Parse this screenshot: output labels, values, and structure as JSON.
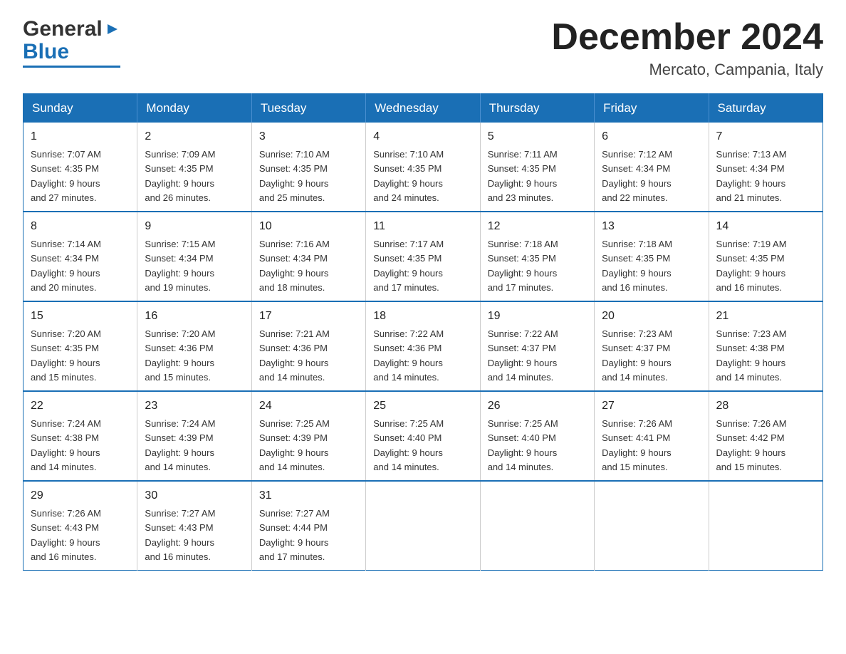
{
  "logo": {
    "general": "General",
    "blue": "Blue"
  },
  "header": {
    "month_year": "December 2024",
    "location": "Mercato, Campania, Italy"
  },
  "days_of_week": [
    "Sunday",
    "Monday",
    "Tuesday",
    "Wednesday",
    "Thursday",
    "Friday",
    "Saturday"
  ],
  "weeks": [
    [
      {
        "day": "1",
        "sunrise": "7:07 AM",
        "sunset": "4:35 PM",
        "daylight": "9 hours and 27 minutes."
      },
      {
        "day": "2",
        "sunrise": "7:09 AM",
        "sunset": "4:35 PM",
        "daylight": "9 hours and 26 minutes."
      },
      {
        "day": "3",
        "sunrise": "7:10 AM",
        "sunset": "4:35 PM",
        "daylight": "9 hours and 25 minutes."
      },
      {
        "day": "4",
        "sunrise": "7:10 AM",
        "sunset": "4:35 PM",
        "daylight": "9 hours and 24 minutes."
      },
      {
        "day": "5",
        "sunrise": "7:11 AM",
        "sunset": "4:35 PM",
        "daylight": "9 hours and 23 minutes."
      },
      {
        "day": "6",
        "sunrise": "7:12 AM",
        "sunset": "4:34 PM",
        "daylight": "9 hours and 22 minutes."
      },
      {
        "day": "7",
        "sunrise": "7:13 AM",
        "sunset": "4:34 PM",
        "daylight": "9 hours and 21 minutes."
      }
    ],
    [
      {
        "day": "8",
        "sunrise": "7:14 AM",
        "sunset": "4:34 PM",
        "daylight": "9 hours and 20 minutes."
      },
      {
        "day": "9",
        "sunrise": "7:15 AM",
        "sunset": "4:34 PM",
        "daylight": "9 hours and 19 minutes."
      },
      {
        "day": "10",
        "sunrise": "7:16 AM",
        "sunset": "4:34 PM",
        "daylight": "9 hours and 18 minutes."
      },
      {
        "day": "11",
        "sunrise": "7:17 AM",
        "sunset": "4:35 PM",
        "daylight": "9 hours and 17 minutes."
      },
      {
        "day": "12",
        "sunrise": "7:18 AM",
        "sunset": "4:35 PM",
        "daylight": "9 hours and 17 minutes."
      },
      {
        "day": "13",
        "sunrise": "7:18 AM",
        "sunset": "4:35 PM",
        "daylight": "9 hours and 16 minutes."
      },
      {
        "day": "14",
        "sunrise": "7:19 AM",
        "sunset": "4:35 PM",
        "daylight": "9 hours and 16 minutes."
      }
    ],
    [
      {
        "day": "15",
        "sunrise": "7:20 AM",
        "sunset": "4:35 PM",
        "daylight": "9 hours and 15 minutes."
      },
      {
        "day": "16",
        "sunrise": "7:20 AM",
        "sunset": "4:36 PM",
        "daylight": "9 hours and 15 minutes."
      },
      {
        "day": "17",
        "sunrise": "7:21 AM",
        "sunset": "4:36 PM",
        "daylight": "9 hours and 14 minutes."
      },
      {
        "day": "18",
        "sunrise": "7:22 AM",
        "sunset": "4:36 PM",
        "daylight": "9 hours and 14 minutes."
      },
      {
        "day": "19",
        "sunrise": "7:22 AM",
        "sunset": "4:37 PM",
        "daylight": "9 hours and 14 minutes."
      },
      {
        "day": "20",
        "sunrise": "7:23 AM",
        "sunset": "4:37 PM",
        "daylight": "9 hours and 14 minutes."
      },
      {
        "day": "21",
        "sunrise": "7:23 AM",
        "sunset": "4:38 PM",
        "daylight": "9 hours and 14 minutes."
      }
    ],
    [
      {
        "day": "22",
        "sunrise": "7:24 AM",
        "sunset": "4:38 PM",
        "daylight": "9 hours and 14 minutes."
      },
      {
        "day": "23",
        "sunrise": "7:24 AM",
        "sunset": "4:39 PM",
        "daylight": "9 hours and 14 minutes."
      },
      {
        "day": "24",
        "sunrise": "7:25 AM",
        "sunset": "4:39 PM",
        "daylight": "9 hours and 14 minutes."
      },
      {
        "day": "25",
        "sunrise": "7:25 AM",
        "sunset": "4:40 PM",
        "daylight": "9 hours and 14 minutes."
      },
      {
        "day": "26",
        "sunrise": "7:25 AM",
        "sunset": "4:40 PM",
        "daylight": "9 hours and 14 minutes."
      },
      {
        "day": "27",
        "sunrise": "7:26 AM",
        "sunset": "4:41 PM",
        "daylight": "9 hours and 15 minutes."
      },
      {
        "day": "28",
        "sunrise": "7:26 AM",
        "sunset": "4:42 PM",
        "daylight": "9 hours and 15 minutes."
      }
    ],
    [
      {
        "day": "29",
        "sunrise": "7:26 AM",
        "sunset": "4:43 PM",
        "daylight": "9 hours and 16 minutes."
      },
      {
        "day": "30",
        "sunrise": "7:27 AM",
        "sunset": "4:43 PM",
        "daylight": "9 hours and 16 minutes."
      },
      {
        "day": "31",
        "sunrise": "7:27 AM",
        "sunset": "4:44 PM",
        "daylight": "9 hours and 17 minutes."
      },
      null,
      null,
      null,
      null
    ]
  ],
  "labels": {
    "sunrise": "Sunrise:",
    "sunset": "Sunset:",
    "daylight": "Daylight:"
  }
}
